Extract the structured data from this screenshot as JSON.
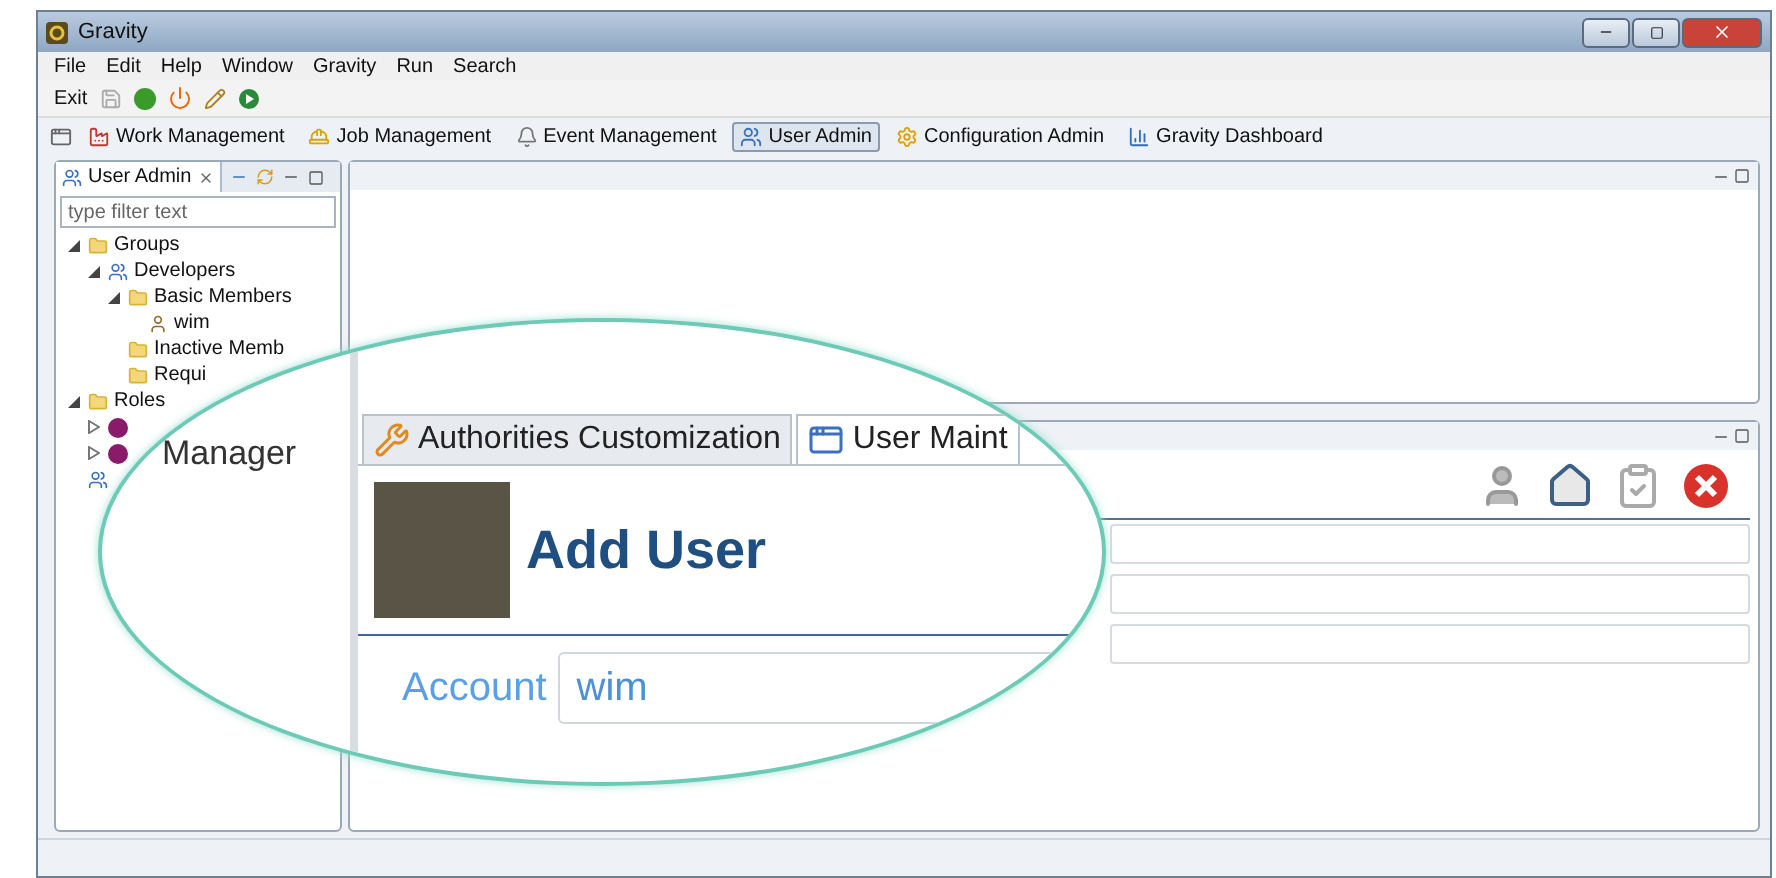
{
  "window": {
    "title": "Gravity"
  },
  "menu": [
    "File",
    "Edit",
    "Help",
    "Window",
    "Gravity",
    "Run",
    "Search"
  ],
  "toolbar": {
    "exit_label": "Exit"
  },
  "perspectives": [
    {
      "label": "Work Management",
      "kind": "factory",
      "selected": false
    },
    {
      "label": "Job Management",
      "kind": "helmet",
      "selected": false
    },
    {
      "label": "Event Management",
      "kind": "bell",
      "selected": false
    },
    {
      "label": "User Admin",
      "kind": "users",
      "selected": true
    },
    {
      "label": "Configuration Admin",
      "kind": "gear",
      "selected": false
    },
    {
      "label": "Gravity Dashboard",
      "kind": "chart",
      "selected": false
    }
  ],
  "user_admin_view": {
    "title": "User Admin",
    "filter": {
      "placeholder": "type filter text"
    },
    "tree": [
      {
        "label": "Groups",
        "kind": "folder",
        "expanded": true,
        "children": [
          {
            "label": "Developers",
            "kind": "group",
            "expanded": true,
            "children": [
              {
                "label": "Basic Members",
                "kind": "folder",
                "expanded": true,
                "children": [
                  {
                    "label": "wim",
                    "kind": "user"
                  }
                ]
              },
              {
                "label": "Inactive Memb",
                "kind": "folder"
              },
              {
                "label": "Requi",
                "kind": "folder"
              }
            ]
          }
        ]
      },
      {
        "label": "Roles",
        "kind": "folder",
        "expanded": true,
        "children": [
          {
            "kind": "role",
            "expanded": false
          },
          {
            "kind": "role",
            "expanded": false
          }
        ]
      },
      {
        "kind": "group"
      }
    ]
  },
  "magnifier": {
    "side_label": "Manager",
    "tabs": [
      {
        "label": "Authorities Customization",
        "kind": "wrench",
        "selected": false
      },
      {
        "label": "User Maint",
        "kind": "window",
        "selected": true
      }
    ],
    "heading": "Add User",
    "fields": [
      {
        "label": "Account",
        "value": "wim"
      }
    ]
  }
}
